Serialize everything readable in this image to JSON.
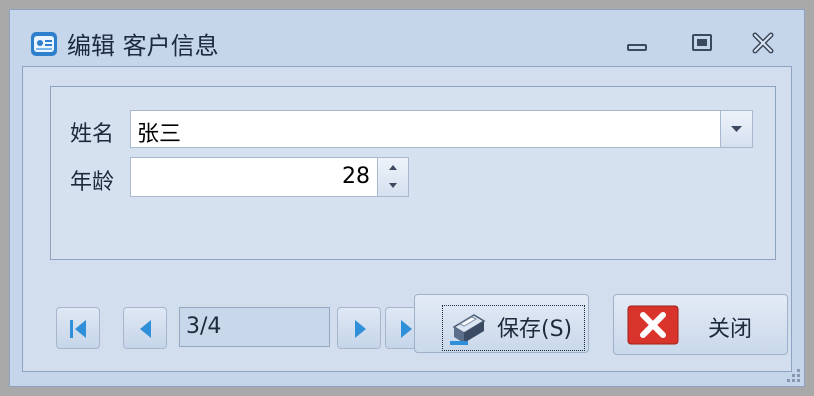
{
  "window": {
    "title": "编辑 客户信息",
    "app_icon": "customer-form-icon",
    "controls": {
      "minimize_icon": "minimize-icon",
      "maximize_icon": "restore-icon",
      "close_icon": "close-window-icon"
    }
  },
  "form": {
    "name_label": "姓名",
    "name_value": "张三",
    "age_label": "年龄",
    "age_value": "28"
  },
  "navigator": {
    "first_icon": "first-record-icon",
    "prev_icon": "previous-record-icon",
    "record_position": "3/4",
    "next_icon": "next-record-icon",
    "last_icon": "last-record-icon"
  },
  "buttons": {
    "save_label": "保存(S)",
    "save_icon": "printer-icon",
    "close_label": "关闭",
    "close_icon": "red-x-icon"
  },
  "colors": {
    "window_bg": "#c5d5ea",
    "border": "#8ea3c2",
    "nav_arrow": "#2f8fd8",
    "close_red": "#d9342b"
  }
}
